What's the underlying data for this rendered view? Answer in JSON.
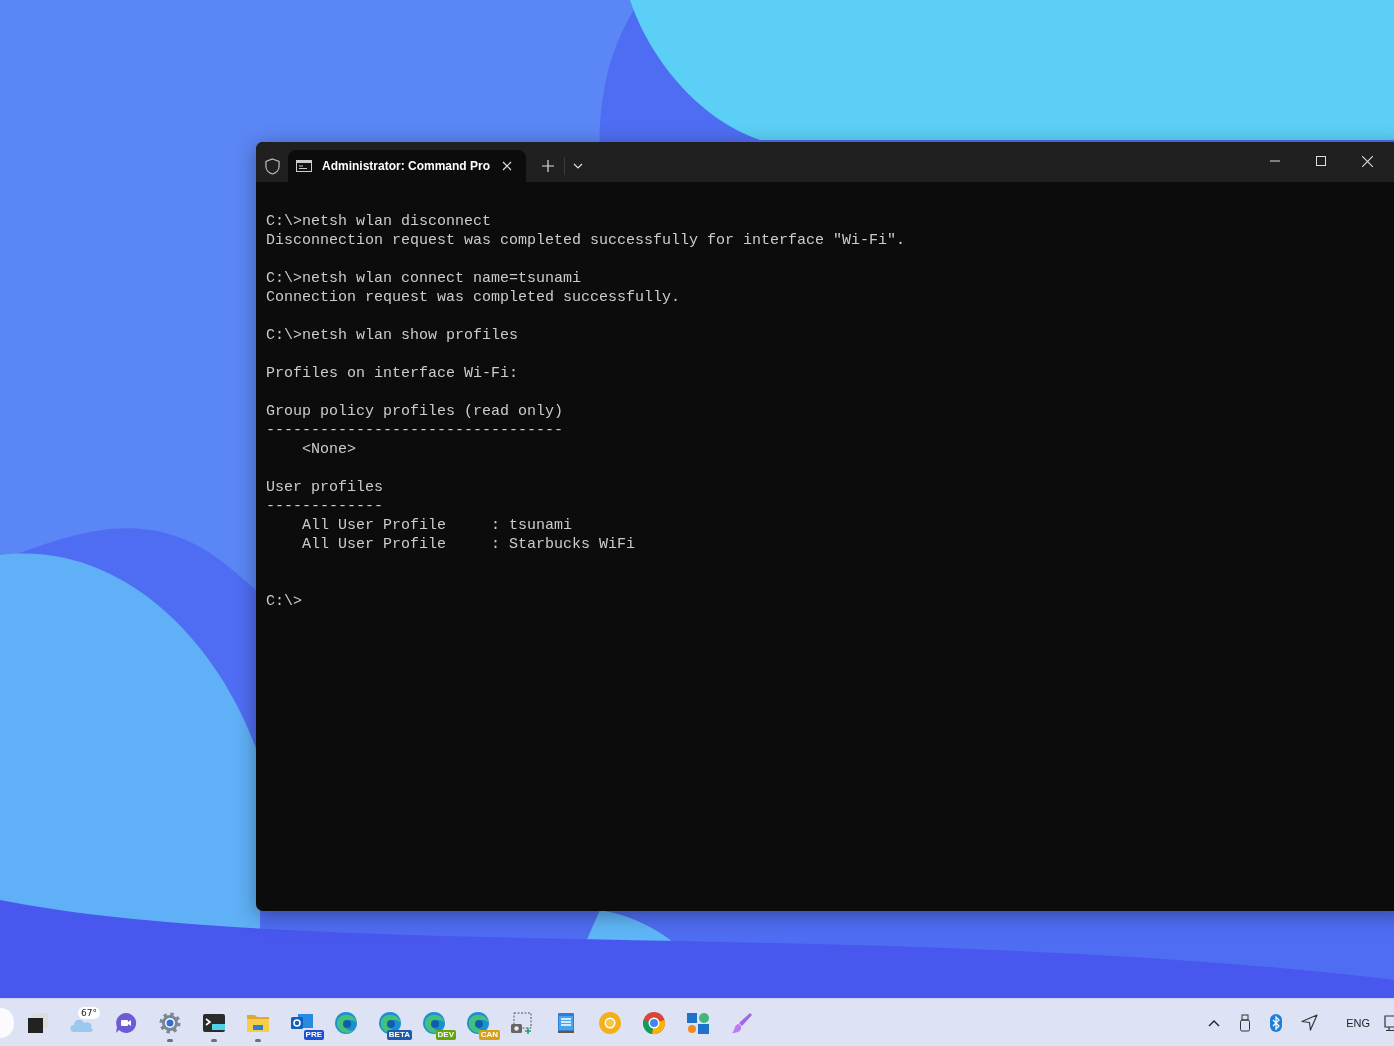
{
  "window": {
    "tab": {
      "title": "Administrator: Command Pro",
      "selected": true
    }
  },
  "terminal": {
    "blocks": [
      [
        "C:\\>netsh wlan disconnect",
        "Disconnection request was completed successfully for interface \"Wi-Fi\"."
      ],
      [
        "C:\\>netsh wlan connect name=tsunami",
        "Connection request was completed successfully."
      ],
      [
        "C:\\>netsh wlan show profiles"
      ],
      [
        "Profiles on interface Wi-Fi:"
      ],
      [
        "Group policy profiles (read only)",
        "---------------------------------",
        "    <None>"
      ],
      [
        "User profiles",
        "-------------",
        "    All User Profile     : tsunami",
        "    All User Profile     : Starbucks WiFi"
      ]
    ],
    "prompt": "C:\\>"
  },
  "taskbar": {
    "apps": [
      {
        "kind": "task-view",
        "running": false
      },
      {
        "kind": "weather",
        "temperature": "67°",
        "running": false
      },
      {
        "kind": "chat",
        "running": false
      },
      {
        "kind": "settings",
        "running": true
      },
      {
        "kind": "terminal",
        "running": true
      },
      {
        "kind": "files",
        "running": true
      },
      {
        "kind": "outlook",
        "badge": "PRE",
        "running": false
      },
      {
        "kind": "edge",
        "running": false
      },
      {
        "kind": "edge",
        "badge": "BETA",
        "running": false
      },
      {
        "kind": "edge",
        "badge": "DEV",
        "running": false
      },
      {
        "kind": "edge",
        "badge": "CAN",
        "running": false
      },
      {
        "kind": "snip",
        "running": false
      },
      {
        "kind": "notepad",
        "running": false
      },
      {
        "kind": "chrome-canary",
        "running": false
      },
      {
        "kind": "chrome",
        "running": false
      },
      {
        "kind": "blocks",
        "running": false
      },
      {
        "kind": "brush",
        "running": false
      }
    ],
    "tray": {
      "language": "ENG"
    }
  }
}
